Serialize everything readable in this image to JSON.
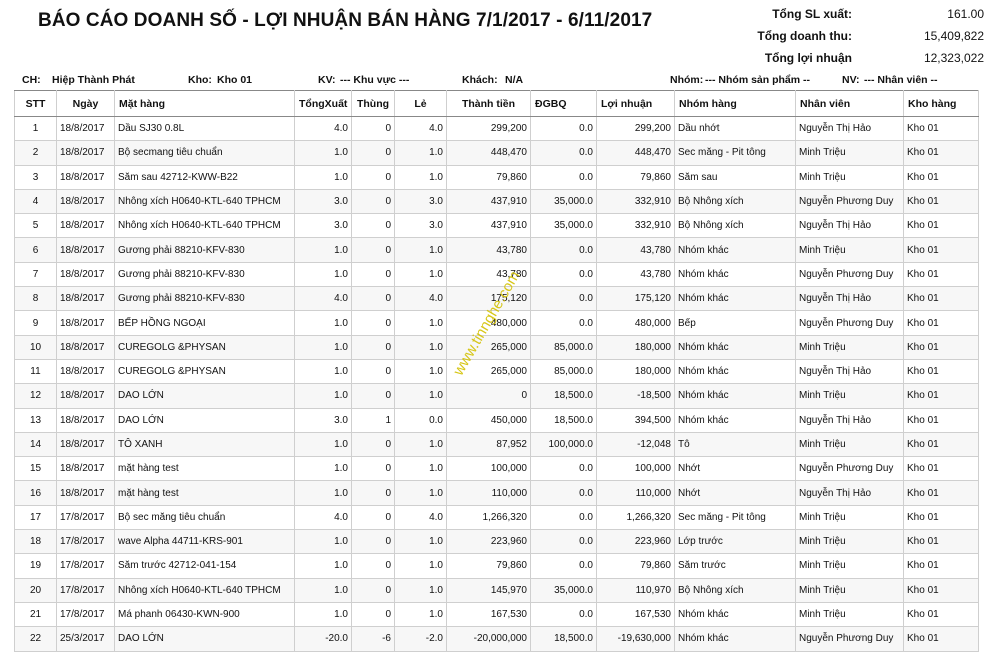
{
  "report": {
    "title": "BÁO CÁO DOANH SỐ - LỢI NHUẬN BÁN HÀNG 7/1/2017 - 6/11/2017"
  },
  "totals": [
    {
      "label": "Tổng SL xuất:",
      "value": "161.00"
    },
    {
      "label": "Tổng doanh thu:",
      "value": "15,409,822"
    },
    {
      "label": "Tổng lợi nhuận",
      "value": "12,323,022"
    }
  ],
  "filters": {
    "ch_label": "CH:",
    "ch_value": "Hiệp Thành Phát",
    "kho_label": "Kho:",
    "kho_value": "Kho 01",
    "kv_label": "KV:",
    "kv_value": "--- Khu vực ---",
    "khach_label": "Khách:",
    "khach_value": "N/A",
    "nhom_label": "Nhóm:",
    "nhom_value": "--- Nhóm sản phẩm --",
    "nv_label": "NV:",
    "nv_value": "--- Nhân viên --"
  },
  "table": {
    "headers": [
      "STT",
      "Ngày",
      "Mặt hàng",
      "TổngXuất",
      "Thùng",
      "Lẻ",
      "Thành tiền",
      "ĐGBQ",
      "Lợi nhuận",
      "Nhóm hàng",
      "Nhân viên",
      "Kho hàng"
    ],
    "rows": [
      [
        "1",
        "18/8/2017",
        "Dầu SJ30 0.8L",
        "4.0",
        "0",
        "4.0",
        "299,200",
        "0.0",
        "299,200",
        "Dầu nhớt",
        "Nguyễn Thị Hảo",
        "Kho 01"
      ],
      [
        "2",
        "18/8/2017",
        "Bộ secmang tiêu chuẩn",
        "1.0",
        "0",
        "1.0",
        "448,470",
        "0.0",
        "448,470",
        "Sec măng - Pit tông",
        "Minh Triệu",
        "Kho 01"
      ],
      [
        "3",
        "18/8/2017",
        "Săm sau 42712-KWW-B22",
        "1.0",
        "0",
        "1.0",
        "79,860",
        "0.0",
        "79,860",
        "Săm sau",
        "Minh Triệu",
        "Kho 01"
      ],
      [
        "4",
        "18/8/2017",
        "Nhông xích H0640-KTL-640 TPHCM",
        "3.0",
        "0",
        "3.0",
        "437,910",
        "35,000.0",
        "332,910",
        "Bộ Nhông xích",
        "Nguyễn Phương Duy",
        "Kho 01"
      ],
      [
        "5",
        "18/8/2017",
        "Nhông xích H0640-KTL-640 TPHCM",
        "3.0",
        "0",
        "3.0",
        "437,910",
        "35,000.0",
        "332,910",
        "Bộ Nhông xích",
        "Nguyễn Thị Hảo",
        "Kho 01"
      ],
      [
        "6",
        "18/8/2017",
        "Gương phải 88210-KFV-830",
        "1.0",
        "0",
        "1.0",
        "43,780",
        "0.0",
        "43,780",
        "Nhóm khác",
        "Minh Triệu",
        "Kho 01"
      ],
      [
        "7",
        "18/8/2017",
        "Gương phải 88210-KFV-830",
        "1.0",
        "0",
        "1.0",
        "43,780",
        "0.0",
        "43,780",
        "Nhóm khác",
        "Nguyễn Phương Duy",
        "Kho 01"
      ],
      [
        "8",
        "18/8/2017",
        "Gương phải 88210-KFV-830",
        "4.0",
        "0",
        "4.0",
        "175,120",
        "0.0",
        "175,120",
        "Nhóm khác",
        "Nguyễn Thị Hảo",
        "Kho 01"
      ],
      [
        "9",
        "18/8/2017",
        "BẾP HỒNG NGOẠI",
        "1.0",
        "0",
        "1.0",
        "480,000",
        "0.0",
        "480,000",
        "Bếp",
        "Nguyễn Phương Duy",
        "Kho 01"
      ],
      [
        "10",
        "18/8/2017",
        "CUREGOLG &PHYSAN",
        "1.0",
        "0",
        "1.0",
        "265,000",
        "85,000.0",
        "180,000",
        "Nhóm khác",
        "Minh Triệu",
        "Kho 01"
      ],
      [
        "11",
        "18/8/2017",
        "CUREGOLG &PHYSAN",
        "1.0",
        "0",
        "1.0",
        "265,000",
        "85,000.0",
        "180,000",
        "Nhóm khác",
        "Nguyễn Thị Hảo",
        "Kho 01"
      ],
      [
        "12",
        "18/8/2017",
        "DAO LỚN",
        "1.0",
        "0",
        "1.0",
        "0",
        "18,500.0",
        "-18,500",
        "Nhóm khác",
        "Minh Triệu",
        "Kho 01"
      ],
      [
        "13",
        "18/8/2017",
        "DAO LỚN",
        "3.0",
        "1",
        "0.0",
        "450,000",
        "18,500.0",
        "394,500",
        "Nhóm khác",
        "Nguyễn Thị Hảo",
        "Kho 01"
      ],
      [
        "14",
        "18/8/2017",
        "TÔ XANH",
        "1.0",
        "0",
        "1.0",
        "87,952",
        "100,000.0",
        "-12,048",
        "Tô",
        "Minh Triệu",
        "Kho 01"
      ],
      [
        "15",
        "18/8/2017",
        "mặt hàng test",
        "1.0",
        "0",
        "1.0",
        "100,000",
        "0.0",
        "100,000",
        "Nhớt",
        "Nguyễn Phương Duy",
        "Kho 01"
      ],
      [
        "16",
        "18/8/2017",
        "mặt hàng test",
        "1.0",
        "0",
        "1.0",
        "110,000",
        "0.0",
        "110,000",
        "Nhớt",
        "Nguyễn Thị Hảo",
        "Kho 01"
      ],
      [
        "17",
        "17/8/2017",
        "Bộ sec măng tiêu chuẩn",
        "4.0",
        "0",
        "4.0",
        "1,266,320",
        "0.0",
        "1,266,320",
        "Sec măng - Pit tông",
        "Minh Triệu",
        "Kho 01"
      ],
      [
        "18",
        "17/8/2017",
        "wave Alpha 44711-KRS-901",
        "1.0",
        "0",
        "1.0",
        "223,960",
        "0.0",
        "223,960",
        "Lớp trước",
        "Minh Triệu",
        "Kho 01"
      ],
      [
        "19",
        "17/8/2017",
        "Săm trước 42712-041-154",
        "1.0",
        "0",
        "1.0",
        "79,860",
        "0.0",
        "79,860",
        "Săm trước",
        "Minh Triệu",
        "Kho 01"
      ],
      [
        "20",
        "17/8/2017",
        "Nhông xích H0640-KTL-640 TPHCM",
        "1.0",
        "0",
        "1.0",
        "145,970",
        "35,000.0",
        "110,970",
        "Bộ Nhông xích",
        "Minh Triệu",
        "Kho 01"
      ],
      [
        "21",
        "17/8/2017",
        "Má phanh 06430-KWN-900",
        "1.0",
        "0",
        "1.0",
        "167,530",
        "0.0",
        "167,530",
        "Nhóm khác",
        "Minh Triệu",
        "Kho 01"
      ],
      [
        "22",
        "25/3/2017",
        "DAO LỚN",
        "-20.0",
        "-6",
        "-2.0",
        "-20,000,000",
        "18,500.0",
        "-19,630,000",
        "Nhóm khác",
        "Nguyễn Phương Duy",
        "Kho 01"
      ]
    ]
  },
  "watermark": "www.tinnghe.com"
}
